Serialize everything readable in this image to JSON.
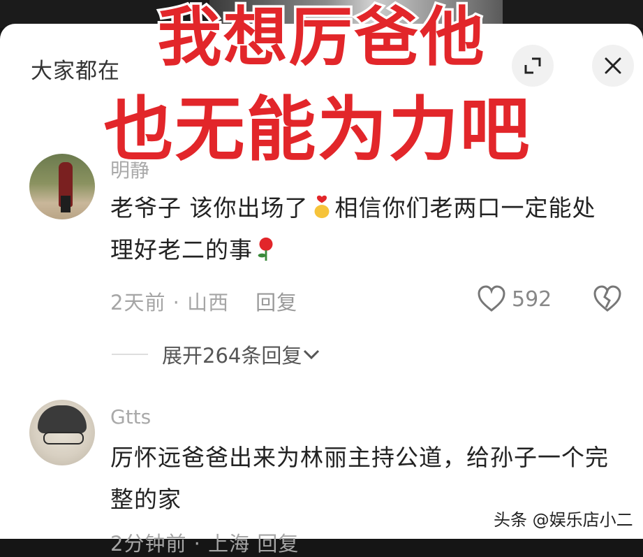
{
  "header": {
    "title": "大家都在"
  },
  "overlay": {
    "line1": "我想厉爸他",
    "line2": "也无能为力吧",
    "color": "#e2262a"
  },
  "comments": [
    {
      "username": "明静",
      "text_a": "老爷子  该你出场了",
      "text_b": "相信你们老两口一定能处理好老二的事",
      "time": "2天前",
      "location": "山西",
      "reply_label": "回复",
      "likes": "592",
      "expand_label": "展开264条回复"
    },
    {
      "username": "Gtts",
      "text": "厉怀远爸爸出来为林丽主持公道，给孙子一个完整的家",
      "meta": "2分钟前 · 上海   回复"
    }
  ],
  "watermark": "头条 @娱乐店小二",
  "icons": [
    "expand-icon",
    "close-icon",
    "heart-icon",
    "broken-heart-icon",
    "chevron-down-icon",
    "finger-heart-emoji",
    "rose-emoji"
  ]
}
